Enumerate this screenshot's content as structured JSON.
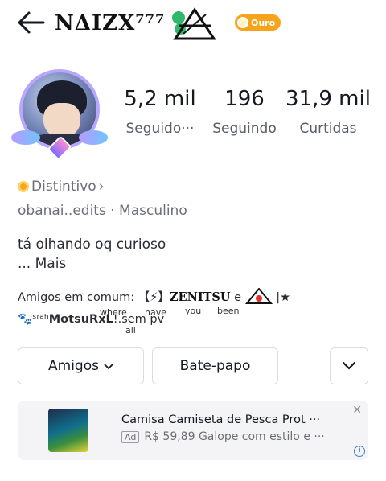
{
  "header": {
    "username": "NΔIZX⁷⁷⁷",
    "badge_label": "Ouro"
  },
  "stats": [
    {
      "value": "5,2 mil",
      "label": "Seguido···"
    },
    {
      "value": "196",
      "label": "Seguindo"
    },
    {
      "value": "31,9 mil",
      "label": "Curtidas"
    }
  ],
  "profile": {
    "distintivo_label": "Distintivo",
    "info_line": "obanai..edits · Masculino",
    "bio_line1": "tá olhando oq curioso",
    "bio_more_prefix": "... ",
    "bio_more_label": "Mais"
  },
  "common_friends": {
    "prefix": "Amigos em comum:",
    "friend1_bracket": "【⚡】",
    "friend1_name": "ZENITSU",
    "friend1_suffix": "e",
    "friend2_trail": "|★",
    "line2": "🐾ˢʳᵃʰ𝗠𝗼𝘁𝘀𝘂𝗥𝘅𝗟!.sem pv"
  },
  "overlay_lyrics": {
    "w1": "where",
    "w2": "have",
    "w3": "you",
    "w4": "been",
    "w5": "all"
  },
  "buttons": {
    "friends_label": "Amigos",
    "chat_label": "Bate-papo"
  },
  "ad": {
    "title": "Camisa Camiseta de Pesca Prot ···",
    "tag": "Ad",
    "subtitle": "R$ 59,89 Galope com estilo e ···",
    "info_symbol": "i",
    "close_symbol": "✕"
  },
  "colors": {
    "badge": "#f7a41d",
    "text": "#161823",
    "muted": "#6d6e76",
    "ad_bg": "#f4f4f6"
  }
}
